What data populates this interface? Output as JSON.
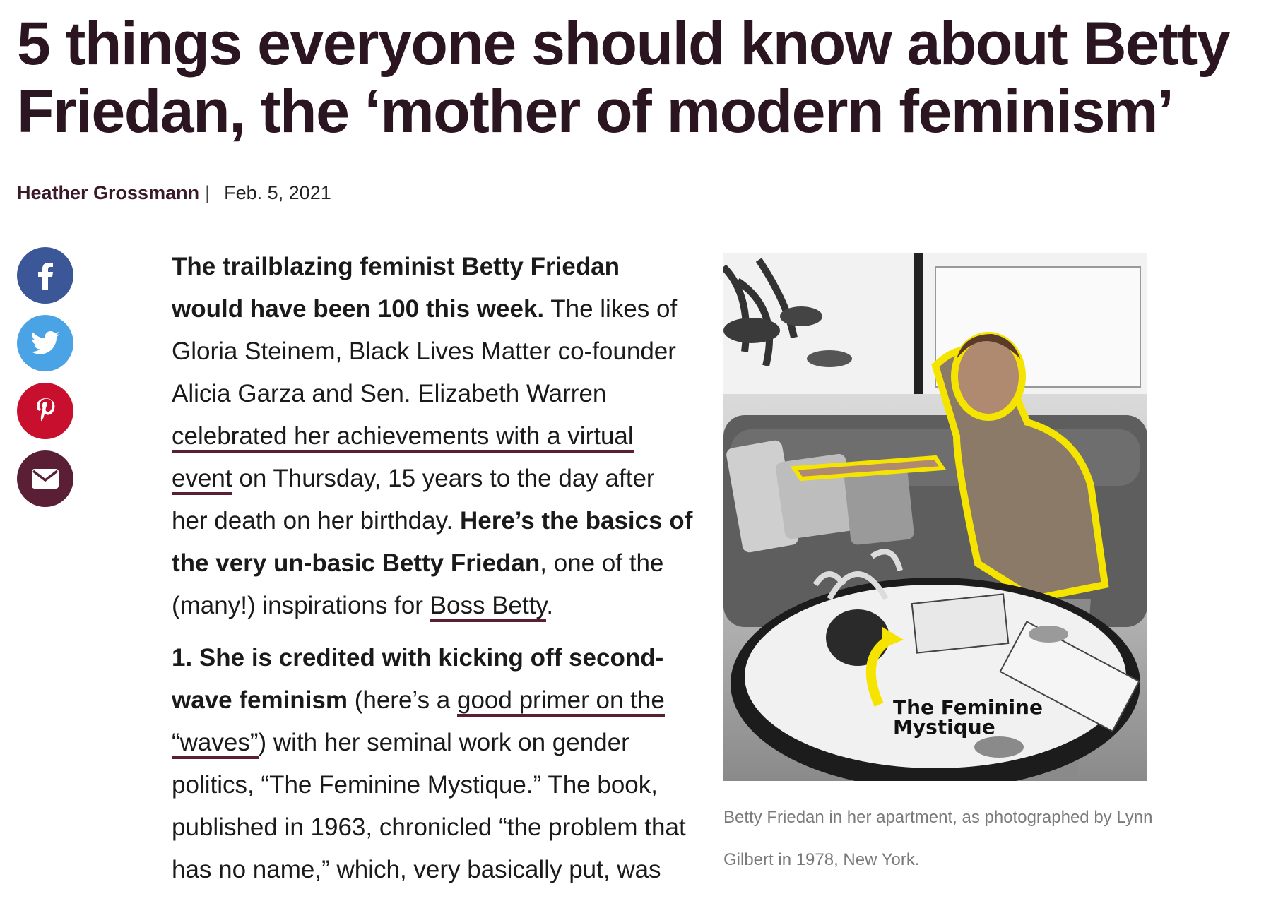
{
  "headline": "5 things everyone should know about Betty Friedan, the ‘mother of modern feminism’",
  "byline": {
    "author": "Heather Grossmann",
    "separator": "|",
    "date": "Feb. 5, 2021"
  },
  "share": {
    "icons": [
      "facebook-icon",
      "twitter-icon",
      "pinterest-icon",
      "email-icon"
    ],
    "colors": {
      "facebook": "#3b5798",
      "twitter": "#4aa3e4",
      "pinterest": "#c8102e",
      "email": "#5a1f34"
    }
  },
  "article": {
    "p1": {
      "bold1": "The trailblazing feminist Betty Friedan would have been 100 this week.",
      "text1": " The likes of Gloria Steinem, Black Lives Matter co-founder Alicia Garza and Sen. Elizabeth Warren ",
      "link1": "celebrated her achievements with a virtual event",
      "text2": " on Thursday, 15 years to the day after her death on her birthday. ",
      "bold2": "Here’s the basics of the very un-basic Betty Friedan",
      "text3": ", one of the (many!) inspirations for ",
      "link2": "Boss Betty",
      "text4": "."
    },
    "p2": {
      "bold1": "1. She is credited with kicking off second-wave feminism",
      "text1": " (here’s a ",
      "link1": "good primer on the “waves”",
      "text2": ") with her seminal work on gender politics, “The Feminine Mystique.” The book, published in 1963, chronicled “the problem that has no name,” which, very basically put, was"
    }
  },
  "figure": {
    "photo_label_line1": "The Feminine",
    "photo_label_line2": "Mystique",
    "caption": "Betty Friedan in her apartment, as photographed by Lynn Gilbert in 1978, New York."
  },
  "colors": {
    "headline": "#2a1520",
    "link_underline": "#5a1f34",
    "highlight": "#f5e400"
  }
}
